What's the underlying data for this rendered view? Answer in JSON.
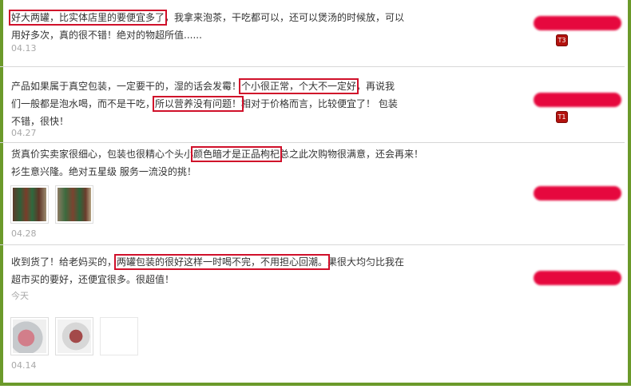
{
  "colors": {
    "highlight_box": "#d0102a",
    "frame": "#6b9a2a",
    "date": "#a8a8a8",
    "username_blur": "#e6083e",
    "badge": "#b3120e"
  },
  "reviews": [
    {
      "lines": [
        [
          "好大两罐，比实体店里的要便宜多了",
          "，我拿来泡茶，干吃都可以，还可以煲汤的时候放，可以"
        ],
        [
          "用好多次，真的很不错！绝对的物超所值......"
        ]
      ],
      "date": "04.13",
      "badge": "T3"
    },
    {
      "lines": [
        [
          "产品如果属于真空包装，一定要干的，湿的话会发霉！",
          "个小很正常，个大不一定好",
          "，再说我"
        ],
        [
          "们一般都是泡水喝，而不是干吃，",
          "所以营养没有问题！",
          "相对于价格而言，比较便宜了！ 包装"
        ],
        [
          "不错，很快！"
        ]
      ],
      "date": "04.27",
      "badge": "T1"
    },
    {
      "lines": [
        [
          "货真价实卖家很细心，包装也很精心个头小",
          "颜色暗才是正品枸杞",
          "总之此次购物很满意，还会再来！"
        ],
        [
          "衫生意兴隆。绝对五星级 服务一流没的挑！"
        ]
      ],
      "date": "04.28"
    },
    {
      "lines": [
        [
          "收到货了！给老妈买的，",
          "两罐包装的很好这样一时喝不完，不用担心回潮。",
          "果很大均匀比我在"
        ],
        [
          "超市买的要好，还便宜很多。很超值！"
        ]
      ],
      "date": "今天",
      "date2": "04.14"
    }
  ]
}
